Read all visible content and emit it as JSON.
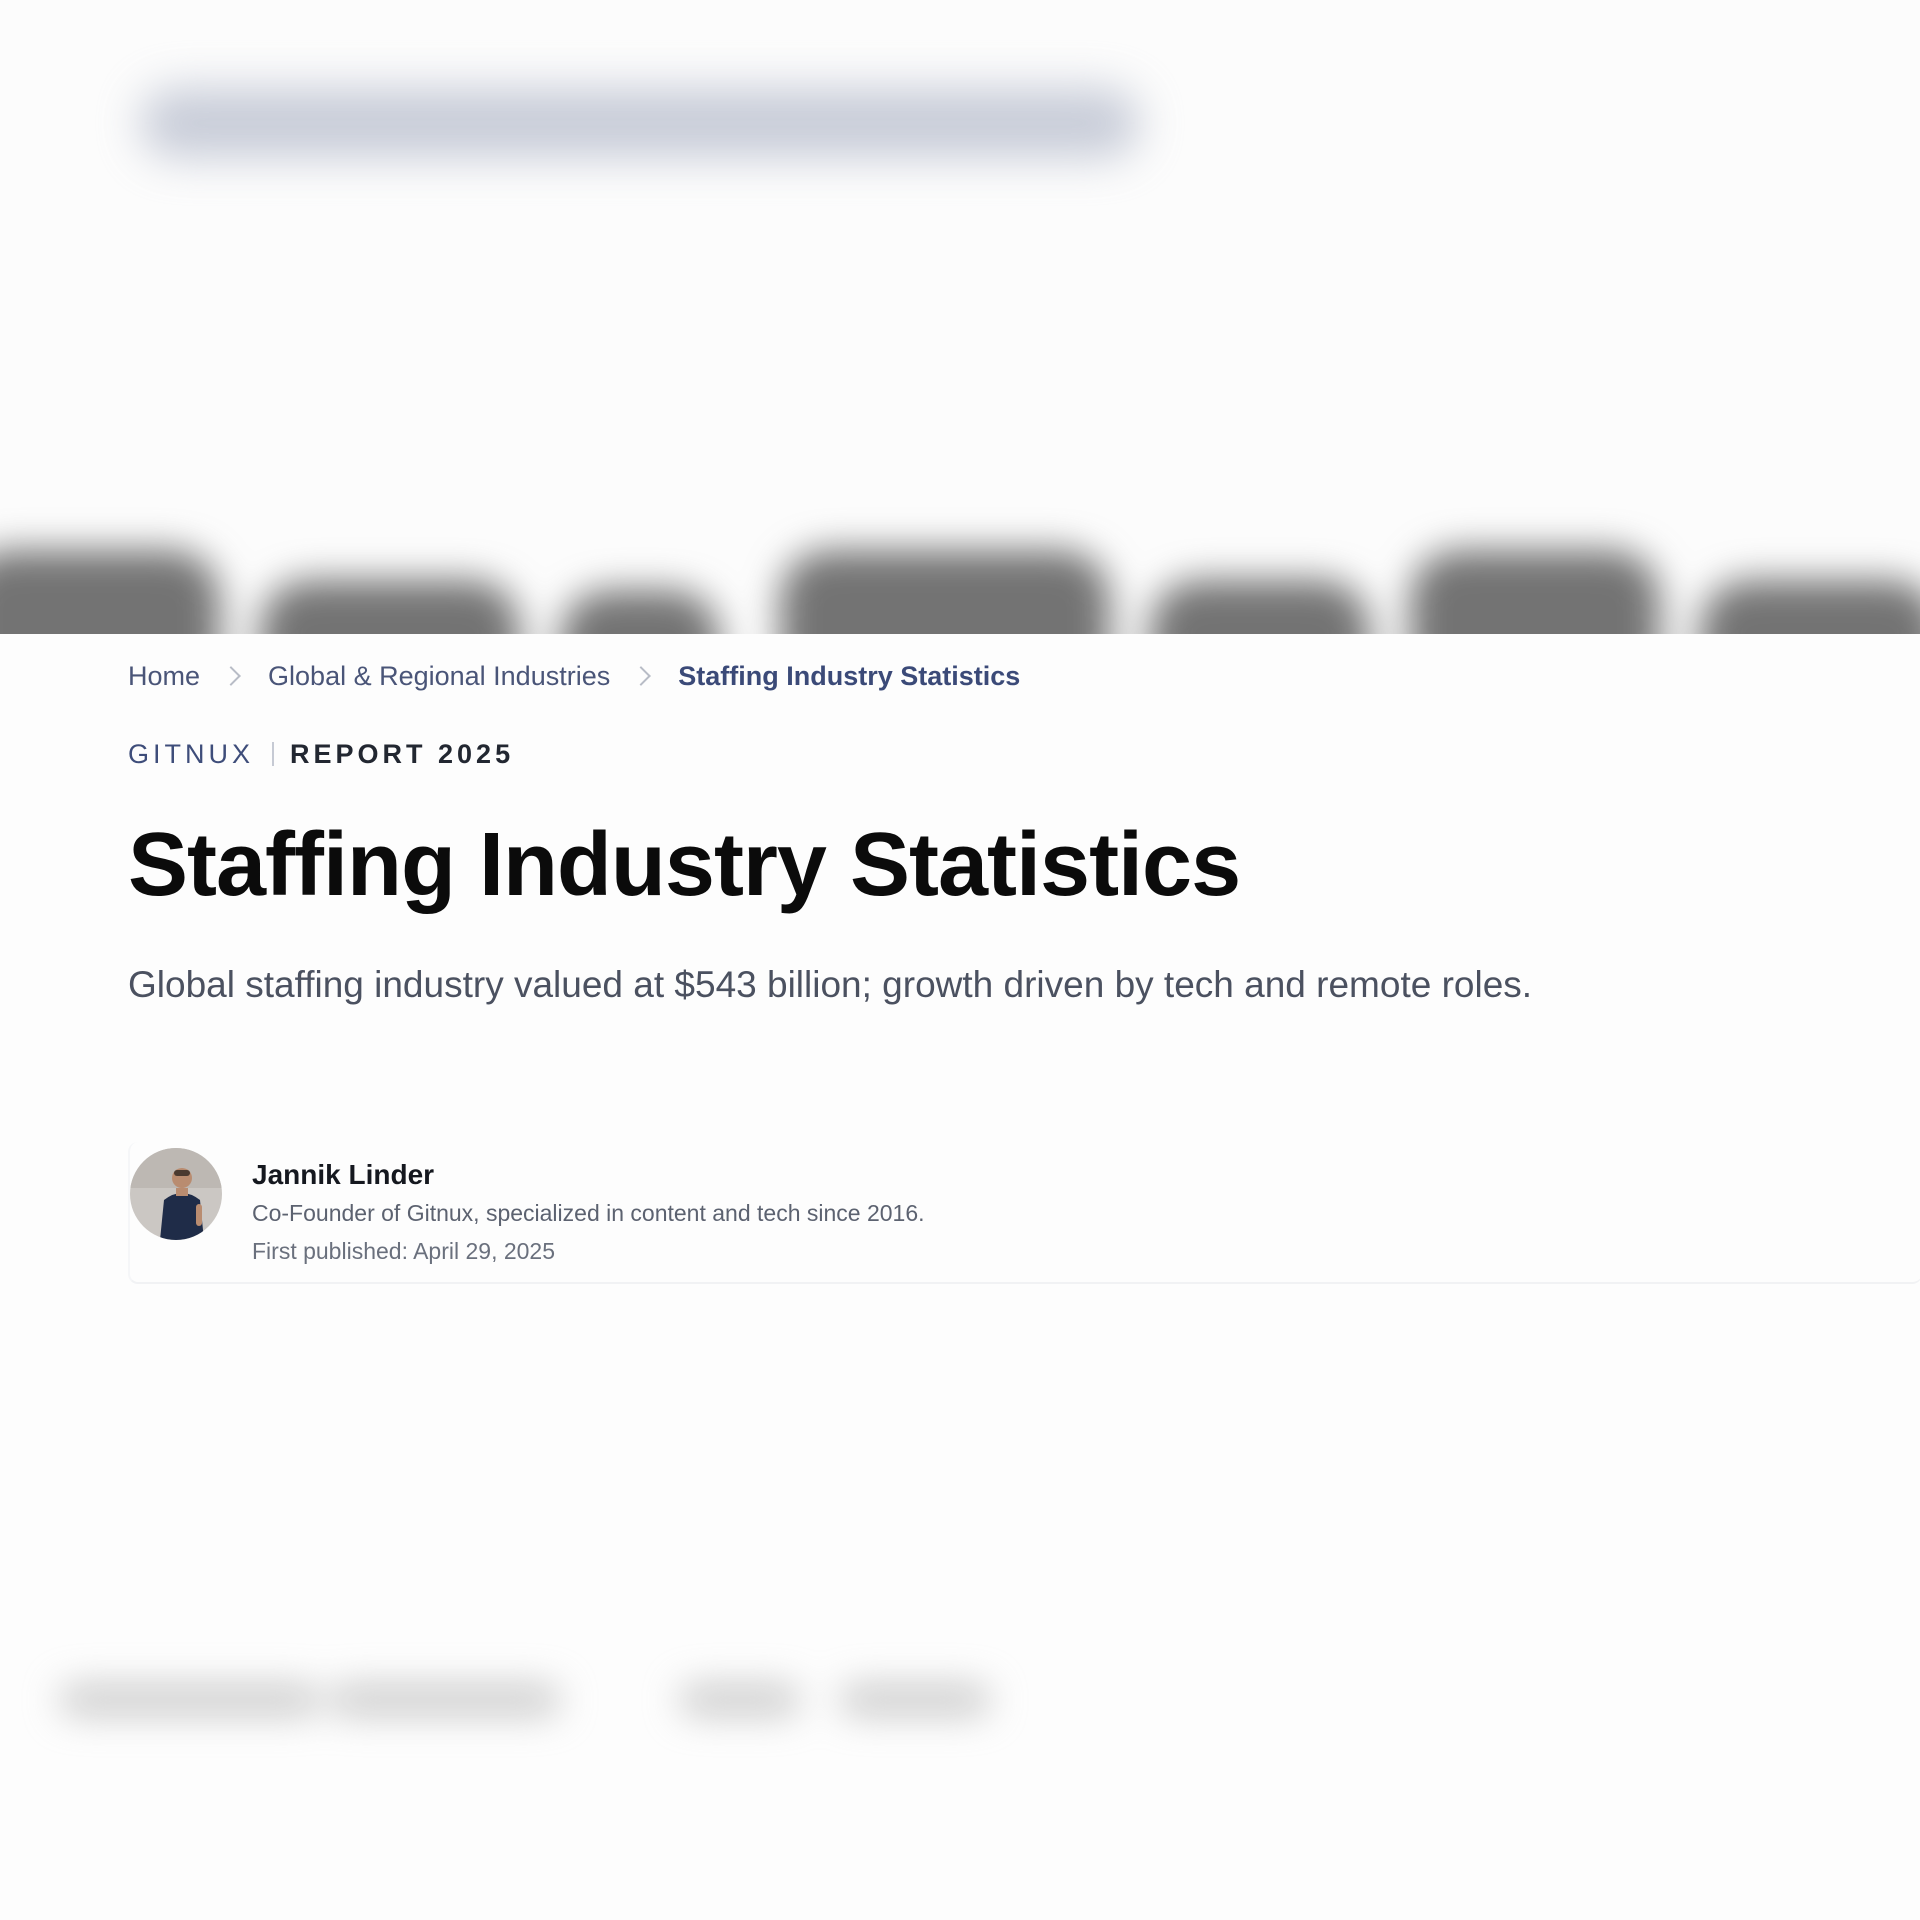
{
  "breadcrumb": {
    "items": [
      "Home",
      "Global & Regional Industries",
      "Staffing Industry Statistics"
    ]
  },
  "kicker": {
    "brand": "GITNUX",
    "report": "REPORT 2025"
  },
  "page": {
    "title": "Staffing Industry Statistics",
    "subtitle": "Global staffing industry valued at $543 billion; growth driven by tech and remote roles."
  },
  "author": {
    "name": "Jannik Linder",
    "bio": "Co-Founder of Gitnux, specialized in content and tech since 2016.",
    "published": "First published: April 29, 2025"
  },
  "colors": {
    "accent": "#3e4d7a",
    "title": "#0b0b0b",
    "subtitle": "#4b5160"
  }
}
